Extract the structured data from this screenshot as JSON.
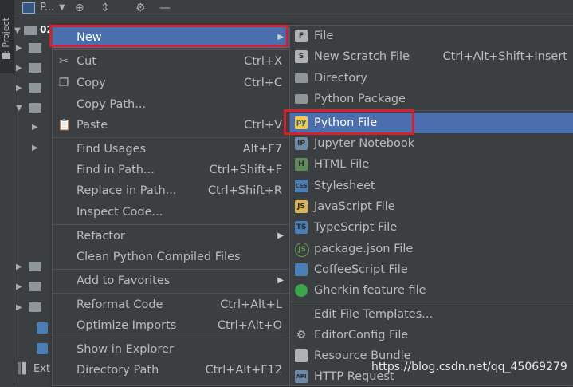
{
  "sidebar": {
    "project_tab": "1: Project"
  },
  "toolbar": {
    "project_selector": "P..."
  },
  "tree": {
    "root_label": "02",
    "ext_label": "Ext"
  },
  "context_menu": {
    "items": [
      {
        "label": "New",
        "shortcut": "",
        "submenu": true
      },
      {
        "label": "Cut",
        "shortcut": "Ctrl+X"
      },
      {
        "label": "Copy",
        "shortcut": "Ctrl+C"
      },
      {
        "label": "Copy Path...",
        "shortcut": ""
      },
      {
        "label": "Paste",
        "shortcut": "Ctrl+V"
      },
      {
        "label": "Find Usages",
        "shortcut": "Alt+F7"
      },
      {
        "label": "Find in Path...",
        "shortcut": "Ctrl+Shift+F"
      },
      {
        "label": "Replace in Path...",
        "shortcut": "Ctrl+Shift+R"
      },
      {
        "label": "Inspect Code...",
        "shortcut": ""
      },
      {
        "label": "Refactor",
        "shortcut": "",
        "submenu": true
      },
      {
        "label": "Clean Python Compiled Files",
        "shortcut": ""
      },
      {
        "label": "Add to Favorites",
        "shortcut": "",
        "submenu": true
      },
      {
        "label": "Reformat Code",
        "shortcut": "Ctrl+Alt+L"
      },
      {
        "label": "Optimize Imports",
        "shortcut": "Ctrl+Alt+O"
      },
      {
        "label": "Show in Explorer",
        "shortcut": ""
      },
      {
        "label": "Directory Path",
        "shortcut": "Ctrl+Alt+F12"
      }
    ]
  },
  "new_submenu": {
    "items": [
      {
        "label": "File",
        "shortcut": "",
        "icon": "F"
      },
      {
        "label": "New Scratch File",
        "shortcut": "Ctrl+Alt+Shift+Insert",
        "icon": "S"
      },
      {
        "label": "Directory",
        "shortcut": "",
        "icon": ""
      },
      {
        "label": "Python Package",
        "shortcut": "",
        "icon": ""
      },
      {
        "label": "Python File",
        "shortcut": "",
        "icon": "py"
      },
      {
        "label": "Jupyter Notebook",
        "shortcut": "",
        "icon": "IP"
      },
      {
        "label": "HTML File",
        "shortcut": "",
        "icon": "H"
      },
      {
        "label": "Stylesheet",
        "shortcut": "",
        "icon": "CSS"
      },
      {
        "label": "JavaScript File",
        "shortcut": "",
        "icon": "JS"
      },
      {
        "label": "TypeScript File",
        "shortcut": "",
        "icon": "TS"
      },
      {
        "label": "package.json File",
        "shortcut": "",
        "icon": "JS"
      },
      {
        "label": "CoffeeScript File",
        "shortcut": "",
        "icon": ""
      },
      {
        "label": "Gherkin feature file",
        "shortcut": "",
        "icon": ""
      },
      {
        "label": "Edit File Templates...",
        "shortcut": "",
        "icon": ""
      },
      {
        "label": "EditorConfig File",
        "shortcut": "",
        "icon": ""
      },
      {
        "label": "Resource Bundle",
        "shortcut": "",
        "icon": ""
      },
      {
        "label": "HTTP Request",
        "shortcut": "",
        "icon": "API"
      }
    ]
  },
  "watermark": "https://blog.csdn.net/qq_45069279",
  "colors": {
    "selection": "#4b6eaf",
    "highlight_box": "#d9202a",
    "background": "#3c3f41"
  }
}
